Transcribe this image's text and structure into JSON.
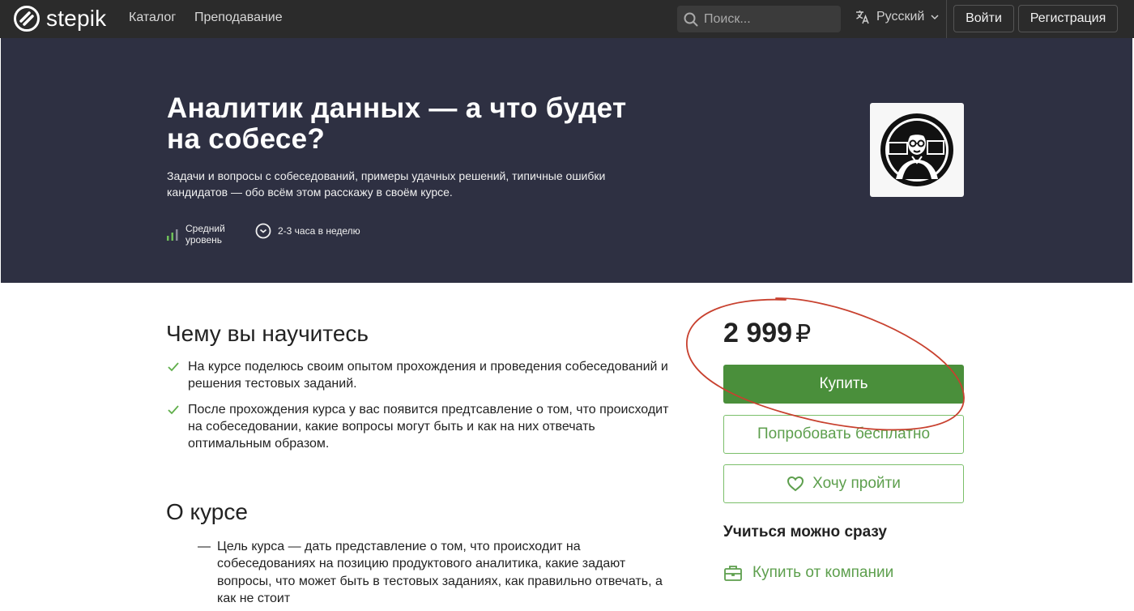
{
  "nav": {
    "logo_text": "stepik",
    "catalog": "Каталог",
    "teaching": "Преподавание",
    "search_placeholder": "Поиск...",
    "language": "Русский",
    "login": "Войти",
    "register": "Регистрация"
  },
  "hero": {
    "title": "Аналитик данных — а что будет на собесе?",
    "description": "Задачи и вопросы с собеседований, примеры удачных решений, типичные ошибки кандидатов — обо всём этом расскажу в своём курсе.",
    "level": "Средний уровень",
    "workload": "2-3 часа в неделю"
  },
  "learn": {
    "heading": "Чему вы научитесь",
    "items": [
      "На курсе поделюсь своим опытом прохождения и проведения собеседований и решения тестовых заданий.",
      "После прохождения курса у вас появится предтсавление о том, что происходит на собеседовании, какие вопросы могут быть и как на них отвечать оптимальным образом."
    ]
  },
  "about": {
    "heading": "О курсе",
    "bullet": "—",
    "text": "Цель курса — дать представление о том, что происходит на собеседованиях на позицию продуктового аналитика, какие задают вопросы, что может быть в тестовых заданиях, как правильно отвечать, а как не стоит"
  },
  "sidebar": {
    "price": "2 999",
    "currency": "₽",
    "buy": "Купить",
    "try_free": "Попробовать бесплатно",
    "wishlist": "Хочу пройти",
    "learn_now": "Учиться можно сразу",
    "buy_company": "Купить от компании"
  },
  "colors": {
    "topbar": "#2b2b2b",
    "hero": "#2e3042",
    "accent_green": "#4a8f3b",
    "annotation_red": "#c8412f"
  },
  "icons": [
    "stepik-logo-icon",
    "search-icon",
    "translate-icon",
    "chevron-down-icon",
    "level-bars-icon",
    "clock-icon",
    "check-icon",
    "heart-icon",
    "briefcase-icon"
  ]
}
